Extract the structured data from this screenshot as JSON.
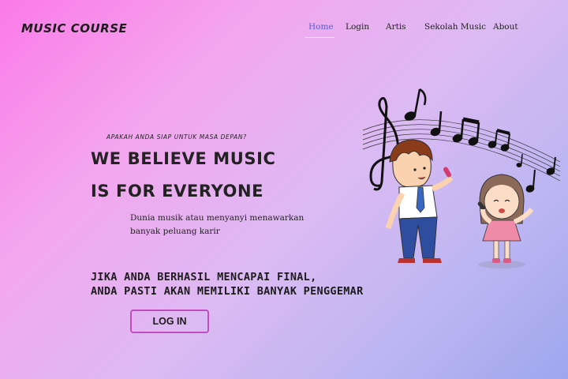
{
  "brand": "MUSIC COURSE",
  "nav": {
    "items": [
      {
        "label": "Home",
        "active": true
      },
      {
        "label": "Login"
      },
      {
        "label": "Artis"
      },
      {
        "label": "Sekolah Music"
      },
      {
        "label": "About"
      }
    ]
  },
  "hero": {
    "tagline": "APAKAH ANDA SIAP UNTUK MASA DEPAN?",
    "headline_line1": "WE BELIEVE  MUSIC",
    "headline_line2": "IS FOR EVERYONE",
    "description_line1": "Dunia musik atau menyanyi menawarkan",
    "description_line2": "banyak peluang karir",
    "cta_line1": "JIKA ANDA BERHASIL MENCAPAI FINAL,",
    "cta_line2": "ANDA PASTI AKAN MEMILIKI BANYAK PENGGEMAR",
    "button_label": "LOG IN"
  },
  "colors": {
    "accent": "#5a5fd6",
    "button_border": "#c04cbd",
    "text": "#222222"
  }
}
